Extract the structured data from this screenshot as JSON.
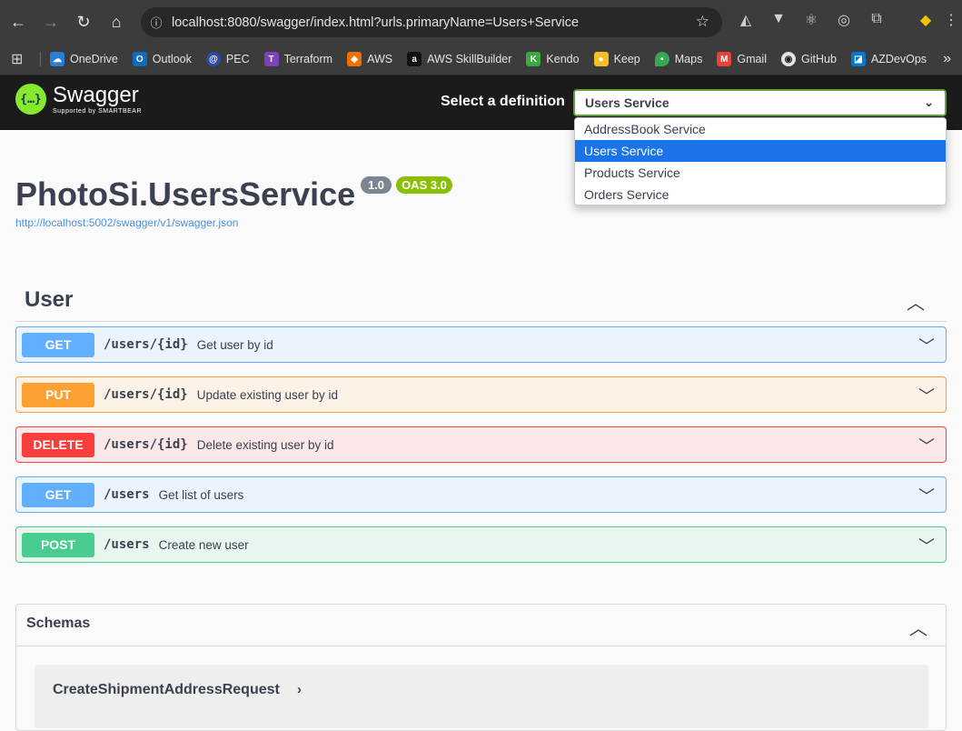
{
  "browser": {
    "url": "localhost:8080/swagger/index.html?urls.primaryName=Users+Service",
    "bookmarks": [
      {
        "label": "OneDrive",
        "icon": "onedrive-icon",
        "color": "#2a7fd4"
      },
      {
        "label": "Outlook",
        "icon": "outlook-icon",
        "color": "#0f6cbd"
      },
      {
        "label": "PEC",
        "icon": "pec-icon",
        "color": "#2d4aa8"
      },
      {
        "label": "Terraform",
        "icon": "terraform-icon",
        "color": "#7b42bc"
      },
      {
        "label": "AWS",
        "icon": "aws-icon",
        "color": "#ed7100"
      },
      {
        "label": "AWS SkillBuilder",
        "icon": "aws-skillbuilder-icon",
        "color": "#111111"
      },
      {
        "label": "Kendo",
        "icon": "kendo-icon",
        "color": "#3aa940"
      },
      {
        "label": "Keep",
        "icon": "keep-icon",
        "color": "#f6bf26"
      },
      {
        "label": "Maps",
        "icon": "maps-icon",
        "color": "#34a853"
      },
      {
        "label": "Gmail",
        "icon": "gmail-icon",
        "color": "#ea4335"
      },
      {
        "label": "GitHub",
        "icon": "github-icon",
        "color": "#e3e3e3"
      },
      {
        "label": "AZDevOps",
        "icon": "azure-devops-icon",
        "color": "#0078d4"
      }
    ]
  },
  "topbar": {
    "logo_title": "Swagger",
    "logo_subtitle": "Supported by SMARTBEAR",
    "definition_label": "Select a definition",
    "selected_definition": "Users Service",
    "definitions": [
      "AddressBook Service",
      "Users Service",
      "Products Service",
      "Orders Service"
    ]
  },
  "info": {
    "title": "PhotoSi.UsersService",
    "version": "1.0",
    "oas": "OAS 3.0",
    "spec_url": "http://localhost:5002/swagger/v1/swagger.json"
  },
  "tag": {
    "name": "User",
    "operations": [
      {
        "method": "GET",
        "path": "/users/{id}",
        "summary": "Get user by id"
      },
      {
        "method": "PUT",
        "path": "/users/{id}",
        "summary": "Update existing user by id"
      },
      {
        "method": "DELETE",
        "path": "/users/{id}",
        "summary": "Delete existing user by id"
      },
      {
        "method": "GET",
        "path": "/users",
        "summary": "Get list of users"
      },
      {
        "method": "POST",
        "path": "/users",
        "summary": "Create new user"
      }
    ]
  },
  "schemas": {
    "title": "Schemas",
    "models": [
      "CreateShipmentAddressRequest"
    ]
  },
  "colors": {
    "get": "#61affe",
    "put": "#fca130",
    "delete": "#f93e3e",
    "post": "#49cc90",
    "swagger_green": "#85ea2d"
  }
}
